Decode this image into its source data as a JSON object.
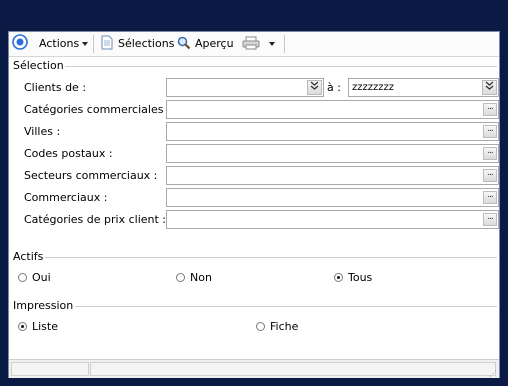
{
  "toolbar": {
    "actions_label": "Actions",
    "selections_label": "Sélections",
    "apercu_label": "Aperçu"
  },
  "selection": {
    "title": "Sélection",
    "clients_label": "Clients de :",
    "clients_from": "",
    "a_label": "à :",
    "clients_to": "zzzzzzzz",
    "fields": [
      {
        "label": "Catégories commerciales :",
        "value": ""
      },
      {
        "label": "Villes :",
        "value": ""
      },
      {
        "label": "Codes postaux :",
        "value": ""
      },
      {
        "label": "Secteurs commerciaux :",
        "value": ""
      },
      {
        "label": "Commerciaux :",
        "value": ""
      },
      {
        "label": "Catégories de prix client :",
        "value": ""
      }
    ]
  },
  "actifs": {
    "title": "Actifs",
    "options": [
      "Oui",
      "Non",
      "Tous"
    ],
    "selected": "Tous"
  },
  "impression": {
    "title": "Impression",
    "options": [
      "Liste",
      "Fiche"
    ],
    "selected": "Liste"
  },
  "icons": {
    "app": "target-icon",
    "selections": "document-icon",
    "apercu": "magnifier-icon",
    "print": "printer-icon",
    "dropdown": "double-chevron-down-icon",
    "ellipsis": "ellipsis-icon"
  }
}
